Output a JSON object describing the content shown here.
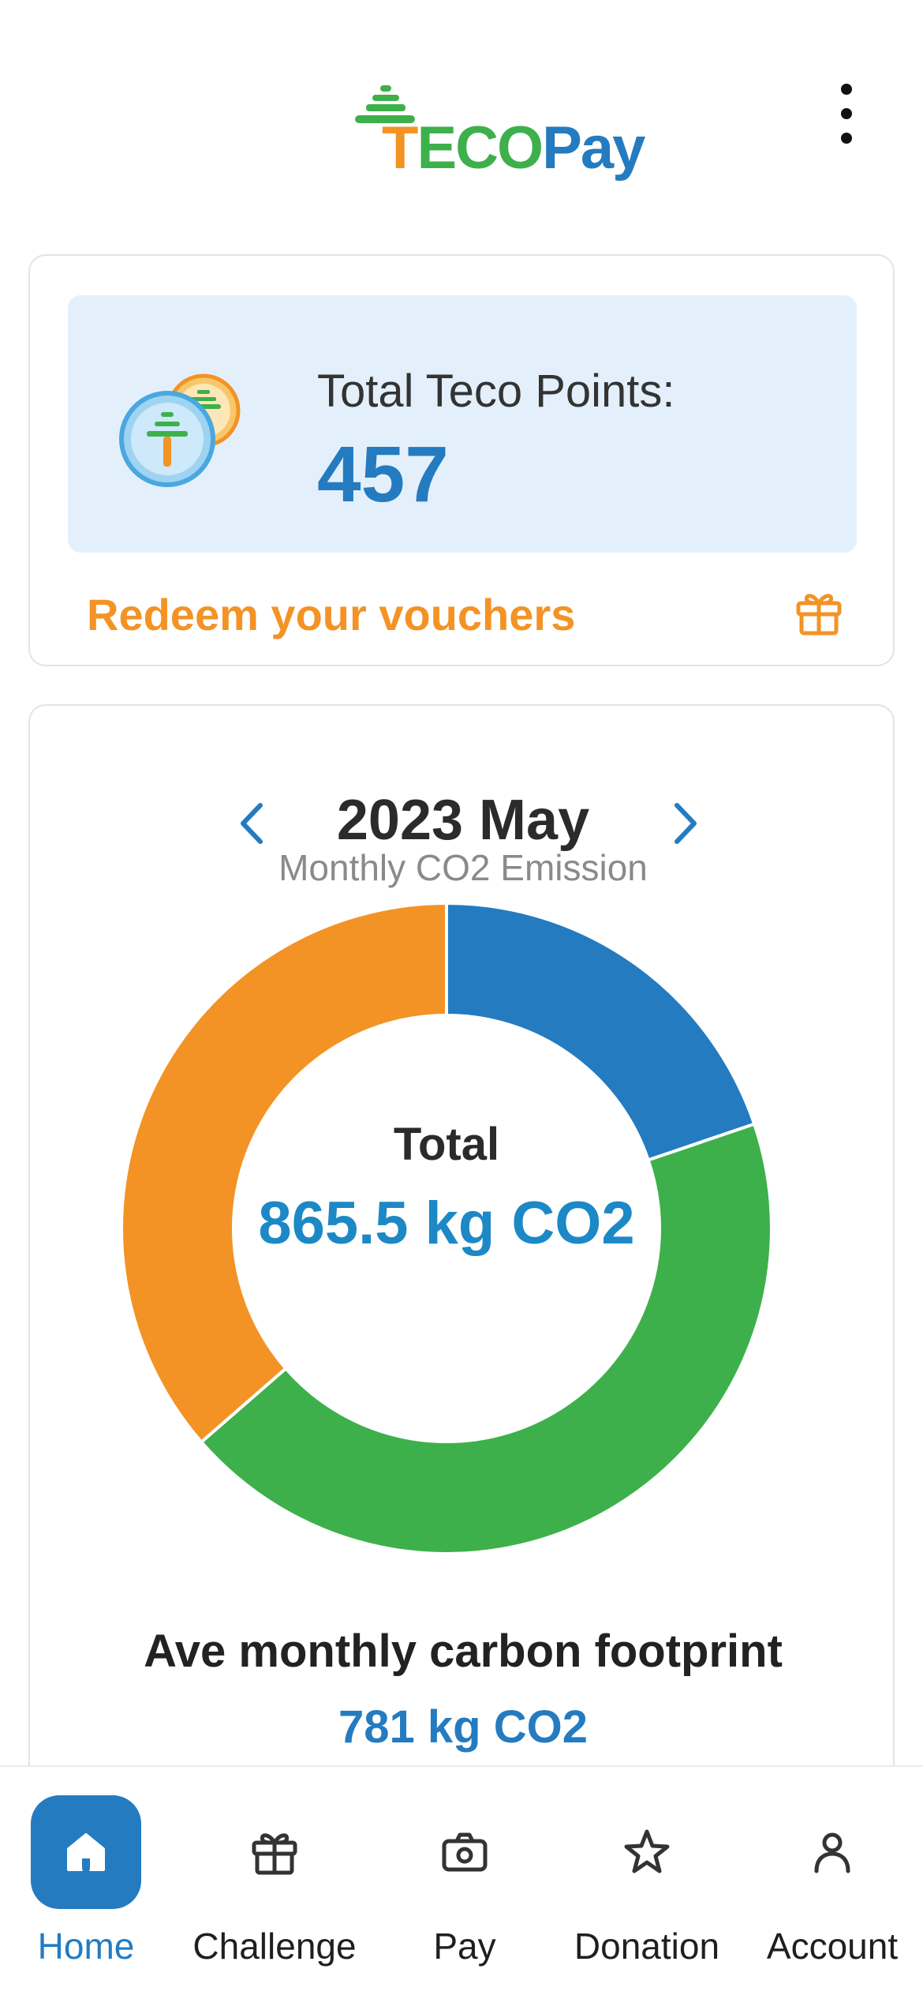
{
  "header": {
    "logo_text_t": "T",
    "logo_text_eco": "ECO",
    "logo_text_pay": "Pay",
    "menu_icon": "more-vertical-icon"
  },
  "points": {
    "label": "Total Teco Points:",
    "value": "457",
    "redeem_label": "Redeem your vouchers",
    "redeem_icon": "gift-icon"
  },
  "emission": {
    "month": "2023 May",
    "subtitle": "Monthly CO2 Emission",
    "total_label": "Total",
    "total_value": "865.5 kg CO2",
    "average_label": "Ave monthly carbon footprint",
    "average_value": "781 kg CO2"
  },
  "chart_data": {
    "type": "pie",
    "title": "",
    "donut": true,
    "series": [
      {
        "color": "#247bc0",
        "value": 0.198
      },
      {
        "color": "#3eb04b",
        "value": 0.438
      },
      {
        "color": "#f39325",
        "value": 0.364
      }
    ]
  },
  "colors": {
    "brand_blue": "#247bc0",
    "brand_green": "#3eb04b",
    "brand_orange": "#f39325",
    "panel_bg": "#e3f0fb"
  },
  "bottom_nav": {
    "items": [
      {
        "label": "Home",
        "icon": "home-icon",
        "active": true
      },
      {
        "label": "Challenge",
        "icon": "gift-icon",
        "active": false
      },
      {
        "label": "Pay",
        "icon": "camera-icon",
        "active": false
      },
      {
        "label": "Donation",
        "icon": "star-icon",
        "active": false
      },
      {
        "label": "Account",
        "icon": "user-icon",
        "active": false
      }
    ]
  }
}
